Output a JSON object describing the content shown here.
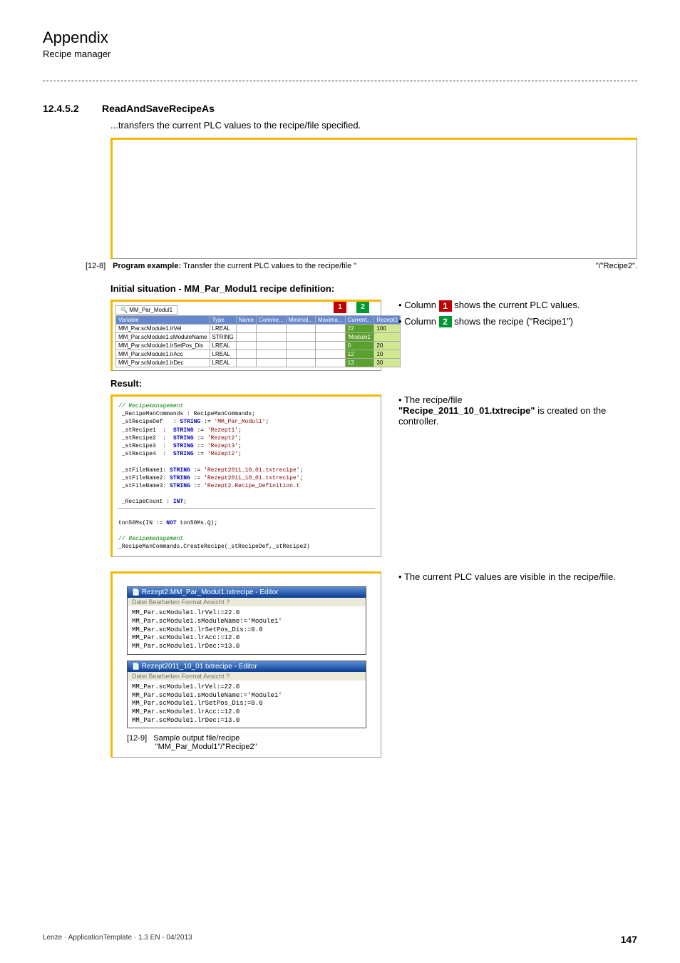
{
  "header": {
    "title": "Appendix",
    "subtitle": "Recipe manager"
  },
  "section": {
    "number": "12.4.5.2",
    "title": "ReadAndSaveRecipeAs",
    "description": "...transfers the current PLC values to the recipe/file specified."
  },
  "caption1": {
    "id": "[12-8]",
    "bold": "Program example:",
    "text": "Transfer the current PLC values to the recipe/file \"",
    "tail": "\"/\"Recipe2\"."
  },
  "subheading_initial": "Initial situation - MM_Par_Modul1 recipe definition:",
  "table": {
    "tab": "MM_Par_Modul1",
    "headers": [
      "Variable",
      "Type",
      "Name",
      "Comme...",
      "Minimal...",
      "Maxima...",
      "Current...",
      "Rezept1"
    ],
    "rows": [
      [
        "MM_Par.scModule1.lrVel",
        "LREAL",
        "",
        "",
        "",
        "",
        "22",
        "100"
      ],
      [
        "MM_Par.scModule1.sModuleName",
        "STRING",
        "",
        "",
        "",
        "",
        "'Module1'",
        ""
      ],
      [
        "MM_Par.scModule1.lrSetPos_Dis",
        "LREAL",
        "",
        "",
        "",
        "",
        "0",
        "20"
      ],
      [
        "MM_Par.scModule1.lrAcc",
        "LREAL",
        "",
        "",
        "",
        "",
        "12",
        "10"
      ],
      [
        "MM_Par.scModule1.lrDec",
        "LREAL",
        "",
        "",
        "",
        "",
        "13",
        "30"
      ]
    ],
    "marker1": "1",
    "marker2": "2"
  },
  "bullets_table": {
    "b1a": "Column",
    "b1b": "shows the current PLC values.",
    "b2a": "Column",
    "b2b": "shows the recipe (\"Recipe1\")"
  },
  "result_heading": "Result:",
  "code": {
    "c1": "// Recipemanagement",
    "c2": "_RecipeManCommands : RecipeManCommands;",
    "c3a": "_stRecipeDef   : ",
    "c3b": "STRING",
    "c3c": " := ",
    "c3d": "'MM_Par_Modul1'",
    "c3e": ";",
    "c4a": "_stRecipe1  :  ",
    "c4b": "STRING",
    "c4c": " := ",
    "c4d": "'Rezept1'",
    "c4e": ";",
    "c5a": "_stRecipe2  :  ",
    "c5b": "STRING",
    "c5c": " := ",
    "c5d": "'Rezept2'",
    "c5e": ";",
    "c6a": "_stRecipe3  :  ",
    "c6b": "STRING",
    "c6c": " := ",
    "c6d": "'Rezept3'",
    "c6e": ";",
    "c7a": "_stRecipe4  :  ",
    "c7b": "STRING",
    "c7c": " := ",
    "c7d": "'Rezept2'",
    "c7e": ";",
    "c8a": "_stFileName1: ",
    "c8b": "STRING",
    "c8c": " := ",
    "c8d": "'Rezept2011_10_01.txtrecipe'",
    "c8e": ";",
    "c9a": "_stFileName2: ",
    "c9b": "STRING",
    "c9c": " := ",
    "c9d": "'Rezept2011_10_01.txtrecipe'",
    "c9e": ";",
    "c10a": "_stFileName3: ",
    "c10b": "STRING",
    "c10c": " := ",
    "c10d": "'Rezept2.Recipe_Definition.t",
    "c11a": "_RecipeCount : ",
    "c11b": "INT",
    "c11c": ";",
    "c12a": "ton50Ms(IN := ",
    "c12b": "NOT",
    "c12c": " ton50Ms.Q);",
    "c13": "// Recipemanagement",
    "c14": "_RecipeManCommands.CreateRecipe(_stRecipeDef,_stRecipe2)"
  },
  "bullets_result": {
    "b1a": "The recipe/file",
    "b1b": "\"Recipe_2011_10_01.txtrecipe\"",
    "b1c": "is created on the controller."
  },
  "editors": {
    "e1_title": "Rezept2.MM_Par_Modul1.txtrecipe - Editor",
    "e2_title": "Rezept2011_10_01.txtrecipe - Editor",
    "menu": "Datei   Bearbeiten   Format   Ansicht   ?",
    "body": "MM_Par.scModule1.lrVel:=22.0\nMM_Par.scModule1.sModuleName:='Module1'\nMM_Par.scModule1.lrSetPos_Dis:=0.0\nMM_Par.scModule1.lrAcc:=12.0\nMM_Par.scModule1.lrDec:=13.0"
  },
  "bullets_editors": {
    "b1": "The current PLC values are visible in the recipe/file."
  },
  "caption2": {
    "id": "[12-9]",
    "line1": "Sample output file/recipe",
    "line2": "\"MM_Par_Modul1\"/\"Recipe2\""
  },
  "footer": {
    "left": "Lenze · ApplicationTemplate · 1.3 EN - 04/2013",
    "right": "147"
  }
}
